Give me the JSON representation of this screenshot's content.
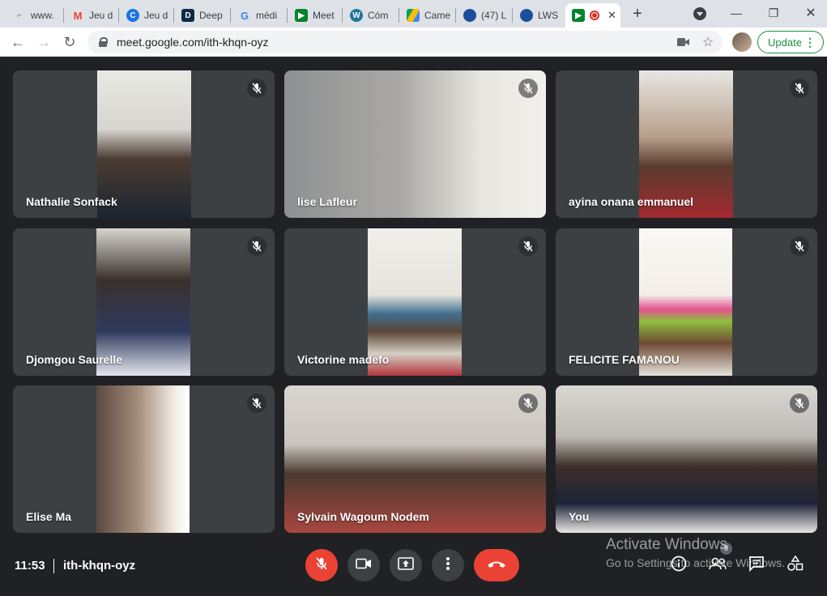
{
  "browser": {
    "tabs": [
      {
        "title": "www.",
        "icon": "generic-page-icon",
        "color": "#5f6368"
      },
      {
        "title": "Jeu d",
        "icon": "gmail-icon",
        "color": "#ea4335"
      },
      {
        "title": "Jeu d",
        "icon": "c-logo-icon",
        "color": "#1a73e8"
      },
      {
        "title": "Deep",
        "icon": "deepl-icon",
        "color": "#0f2b46"
      },
      {
        "title": "médi",
        "icon": "google-icon",
        "color": "#4285f4"
      },
      {
        "title": "Meet",
        "icon": "meet-icon",
        "color": "#00832d"
      },
      {
        "title": "Cóm",
        "icon": "wordpress-icon",
        "color": "#21759b"
      },
      {
        "title": "Came",
        "icon": "drive-icon",
        "color": "#fbbc04"
      },
      {
        "title": "(47) L",
        "icon": "lws-icon",
        "color": "#1b4f9c"
      },
      {
        "title": "LWS",
        "icon": "lws-icon",
        "color": "#1b4f9c"
      }
    ],
    "active_tab_icon": "meet-icon",
    "url": "meet.google.com/ith-khqn-oyz",
    "update_label": "Update"
  },
  "participants": [
    {
      "name": "Nathalie Sonfack",
      "video_color": "#6d6a60",
      "muted": true
    },
    {
      "name": "lise Lafleur",
      "video_color": "#a8a59a",
      "muted": true
    },
    {
      "name": "ayina onana emmanuel",
      "video_color": "#8b7560",
      "muted": true
    },
    {
      "name": "Djomgou Saurelle",
      "video_color": "#8e8a86",
      "muted": true
    },
    {
      "name": "Victorine madefo",
      "video_color": "#b7a998",
      "muted": true
    },
    {
      "name": "FELICITE FAMANOU",
      "video_color": "#d9cfc3",
      "muted": true
    },
    {
      "name": "Elise Ma",
      "video_color": "#7a6a5e",
      "muted": true
    },
    {
      "name": "Sylvain Wagoum Nodem",
      "video_color": "#b4a79a",
      "muted": true
    },
    {
      "name": "You",
      "video_color": "#9a9890",
      "muted": true
    }
  ],
  "meeting": {
    "time": "11:53",
    "code": "ith-khqn-oyz",
    "people_count": "9"
  },
  "watermark": {
    "line1": "Activate Windows",
    "line2": "Go to Settings to activate Windows."
  }
}
